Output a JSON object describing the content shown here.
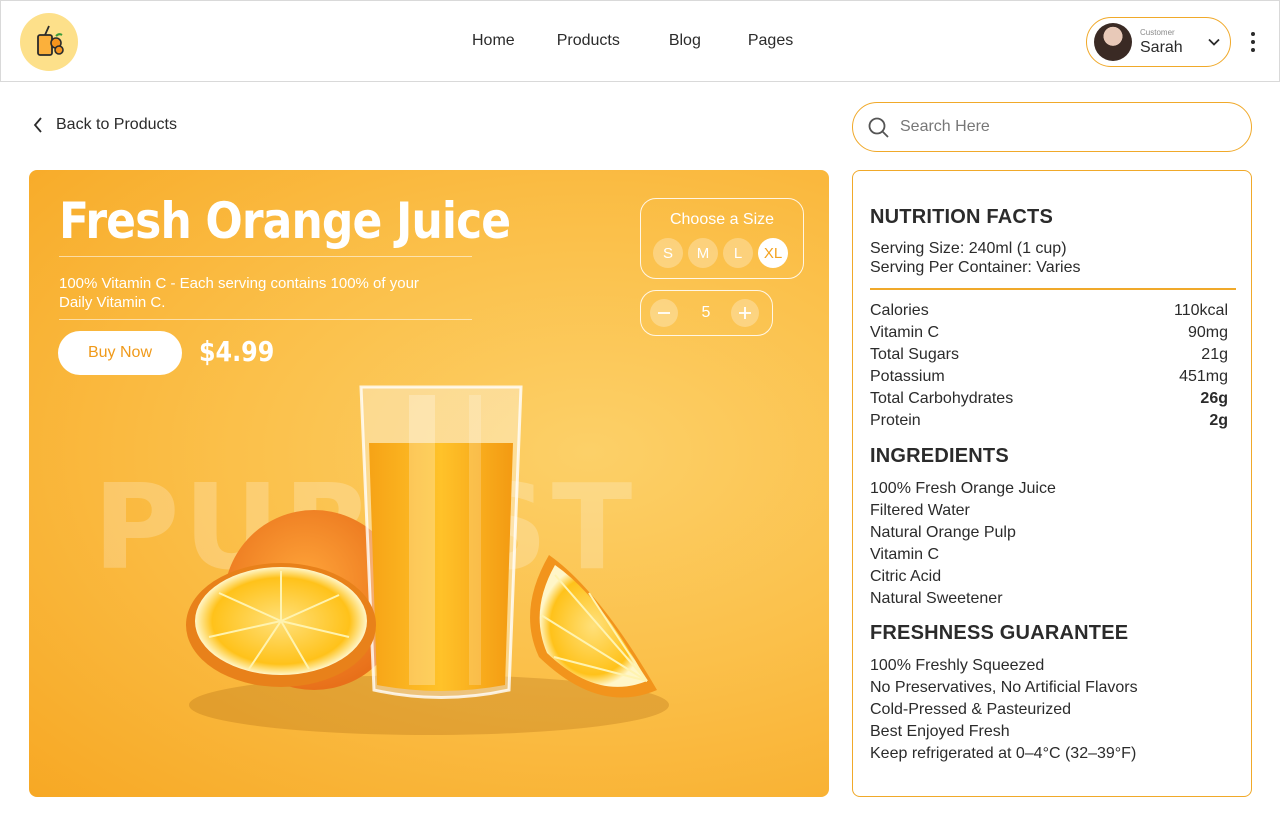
{
  "header": {
    "nav": [
      "Home",
      "Products",
      "Blog",
      "Pages"
    ],
    "user": {
      "role": "Customer",
      "name": "Sarah"
    }
  },
  "back_label": "Back to Products",
  "search": {
    "placeholder": "Search Here",
    "value": ""
  },
  "hero": {
    "title": "Fresh Orange Juice",
    "description": "100% Vitamin C - Each serving contains 100% of your Daily Vitamin C.",
    "buy_label": "Buy Now",
    "price": "$4.99",
    "watermark": "PUREST",
    "size_label": "Choose a Size",
    "sizes": [
      "S",
      "M",
      "L",
      "XL"
    ],
    "selected_size": "XL",
    "quantity": "5"
  },
  "nutrition": {
    "title": "NUTRITION FACTS",
    "serving_size": "Serving Size: 240ml (1 cup)",
    "serving_per_container": "Serving Per Container: Varies",
    "rows": [
      {
        "label": "Calories",
        "value": "110kcal"
      },
      {
        "label": "Vitamin C",
        "value": "90mg"
      },
      {
        "label": "Total Sugars",
        "value": "21g"
      },
      {
        "label": "Potassium",
        "value": "451mg"
      },
      {
        "label": "Total Carbohydrates",
        "value": "26g"
      },
      {
        "label": "Protein",
        "value": "2g"
      }
    ],
    "ingredients_title": "INGREDIENTS",
    "ingredients": [
      "100% Fresh Orange Juice",
      "Filtered Water",
      "Natural Orange Pulp",
      "Vitamin C",
      "Citric Acid",
      "Natural Sweetener"
    ],
    "freshness_title": "FRESHNESS GUARANTEE",
    "freshness": [
      "100% Freshly Squeezed",
      "No Preservatives, No Artificial Flavors",
      "Cold-Pressed & Pasteurized",
      "Best Enjoyed Fresh",
      "Keep refrigerated at 0–4°C (32–39°F)"
    ]
  },
  "colors": {
    "accent": "#f0a92a",
    "hero_orange": "#f7a824"
  }
}
